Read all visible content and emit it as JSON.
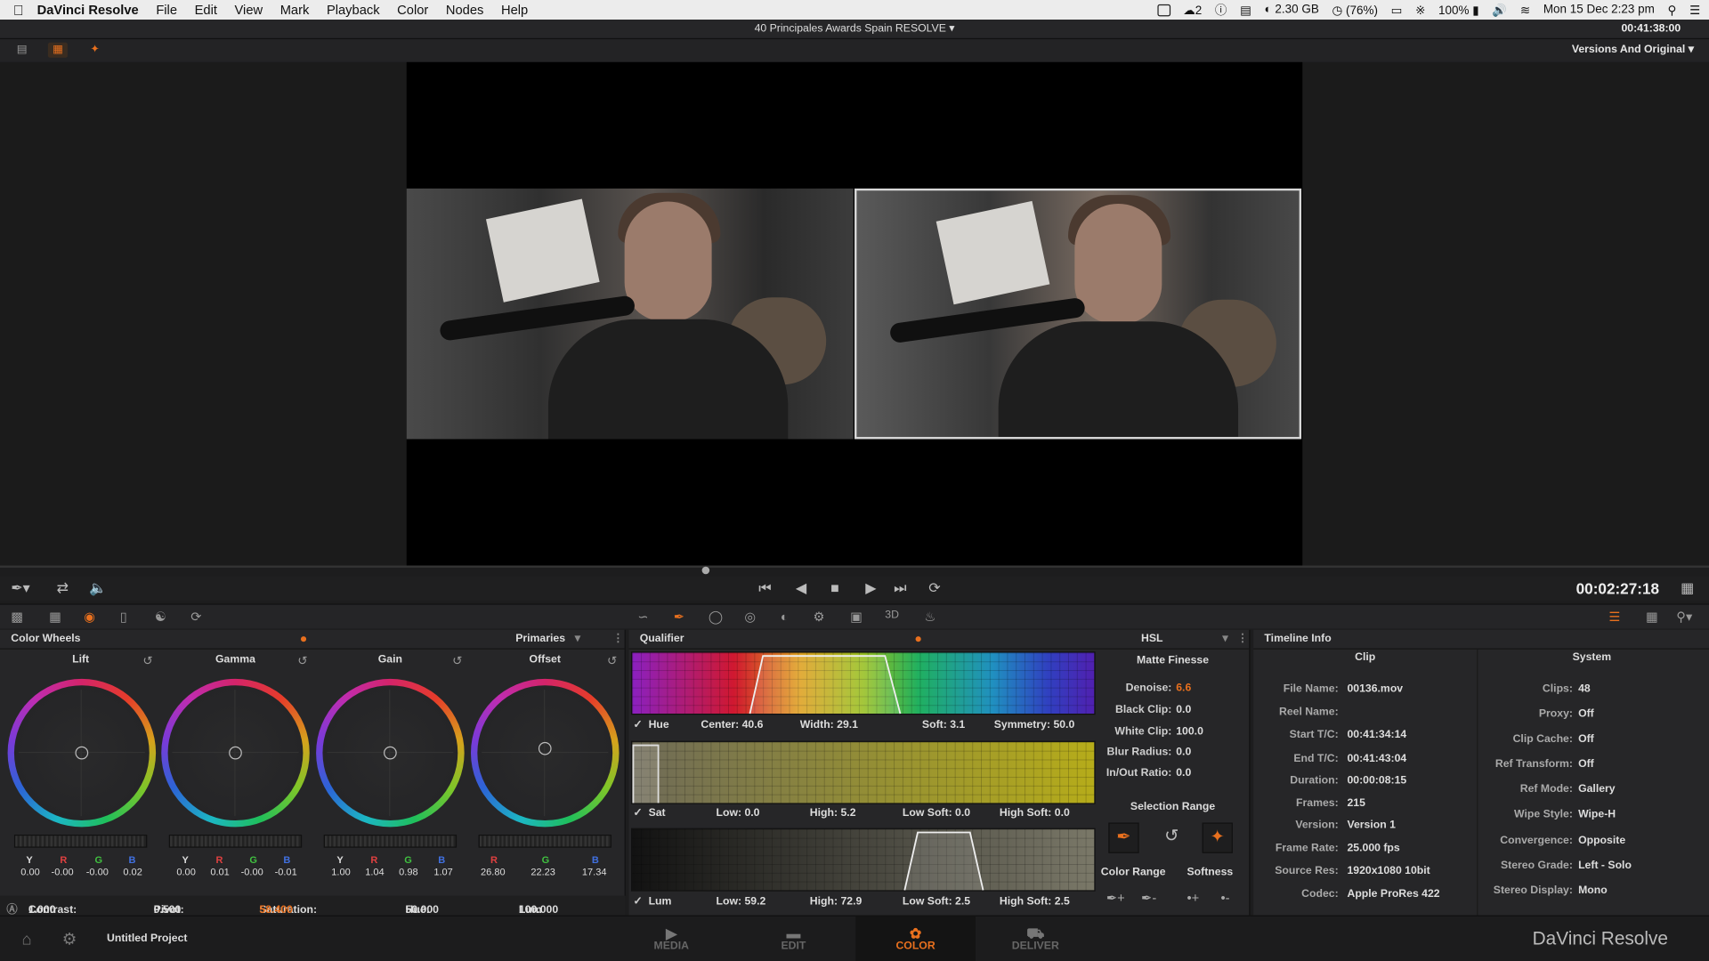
{
  "menubar": {
    "app": "DaVinci Resolve",
    "items": [
      "File",
      "Edit",
      "View",
      "Mark",
      "Playback",
      "Color",
      "Nodes",
      "Help"
    ],
    "status": {
      "cc_count": "2",
      "memory": "2.30 GB",
      "cpu": "(76%)",
      "battery": "100%",
      "datetime": "Mon 15 Dec  2:23 pm"
    }
  },
  "titlebar": {
    "project_title": "40 Principales Awards Spain RESOLVE",
    "timecode": "00:41:38:00"
  },
  "viewer": {
    "mode_label": "Versions And Original"
  },
  "transport": {
    "timecode": "00:02:27:18"
  },
  "color_wheels": {
    "title": "Color Wheels",
    "mode": "Primaries",
    "wheels": [
      {
        "name": "Lift",
        "y": "0.00",
        "r": "-0.00",
        "g": "-0.00",
        "b": "0.02"
      },
      {
        "name": "Gamma",
        "y": "0.00",
        "r": "0.01",
        "g": "-0.00",
        "b": "-0.01"
      },
      {
        "name": "Gain",
        "y": "1.00",
        "r": "1.04",
        "g": "0.98",
        "b": "1.07"
      },
      {
        "name": "Offset",
        "r": "26.80",
        "g": "22.23",
        "b": "17.34"
      }
    ],
    "channel_labels": {
      "y": "Y",
      "r": "R",
      "g": "G",
      "b": "B"
    },
    "bottom": {
      "contrast_label": "Contrast:",
      "contrast": "1.000",
      "pivot_label": "Pivot:",
      "pivot": "0.500",
      "saturation_label": "Saturation:",
      "saturation": "58.400",
      "hue_label": "Hue:",
      "hue": "50.000",
      "lummix_label": "Lum Mix:",
      "lummix": "100.000"
    }
  },
  "qualifier": {
    "title": "Qualifier",
    "mode": "HSL",
    "hue": {
      "label": "Hue",
      "center": "Center: 40.6",
      "width": "Width: 29.1",
      "soft": "Soft: 3.1",
      "symmetry": "Symmetry: 50.0"
    },
    "sat": {
      "label": "Sat",
      "low": "Low: 0.0",
      "high": "High: 5.2",
      "low_soft": "Low Soft: 0.0",
      "high_soft": "High Soft: 0.0"
    },
    "lum": {
      "label": "Lum",
      "low": "Low: 59.2",
      "high": "High: 72.9",
      "low_soft": "Low Soft: 2.5",
      "high_soft": "High Soft: 2.5"
    },
    "matte_finesse": {
      "title": "Matte Finesse",
      "rows": [
        {
          "k": "Denoise:",
          "v": "6.6",
          "accent": true
        },
        {
          "k": "Black Clip:",
          "v": "0.0"
        },
        {
          "k": "White Clip:",
          "v": "100.0"
        },
        {
          "k": "Blur Radius:",
          "v": "0.0"
        },
        {
          "k": "In/Out Ratio:",
          "v": "0.0"
        }
      ]
    },
    "selection_range": "Selection Range",
    "color_range": "Color Range",
    "softness": "Softness"
  },
  "timeline_info": {
    "title": "Timeline Info",
    "clip_header": "Clip",
    "system_header": "System",
    "clip": [
      {
        "k": "File Name:",
        "v": "00136.mov"
      },
      {
        "k": "Reel Name:",
        "v": ""
      },
      {
        "k": "Start T/C:",
        "v": "00:41:34:14"
      },
      {
        "k": "End T/C:",
        "v": "00:41:43:04"
      },
      {
        "k": "Duration:",
        "v": "00:00:08:15"
      },
      {
        "k": "Frames:",
        "v": "215"
      },
      {
        "k": "Version:",
        "v": "Version 1"
      },
      {
        "k": "Frame Rate:",
        "v": "25.000 fps"
      },
      {
        "k": "Source Res:",
        "v": "1920x1080 10bit"
      },
      {
        "k": "Codec:",
        "v": "Apple ProRes 422"
      }
    ],
    "system": [
      {
        "k": "Clips:",
        "v": "48"
      },
      {
        "k": "Proxy:",
        "v": "Off"
      },
      {
        "k": "Clip Cache:",
        "v": "Off"
      },
      {
        "k": "Ref Transform:",
        "v": "Off"
      },
      {
        "k": "Ref Mode:",
        "v": "Gallery"
      },
      {
        "k": "Wipe Style:",
        "v": "Wipe-H"
      },
      {
        "k": "Convergence:",
        "v": "Opposite"
      },
      {
        "k": "Stereo Grade:",
        "v": "Left - Solo"
      },
      {
        "k": "Stereo Display:",
        "v": "Mono"
      }
    ]
  },
  "bottom_nav": {
    "project_name": "Untitled Project",
    "tabs": [
      "MEDIA",
      "EDIT",
      "COLOR",
      "DELIVER"
    ],
    "active_tab": "COLOR",
    "brand": "DaVinci Resolve"
  },
  "colors": {
    "accent": "#e8701e",
    "panel": "#262628",
    "background": "#1d1d1e"
  }
}
